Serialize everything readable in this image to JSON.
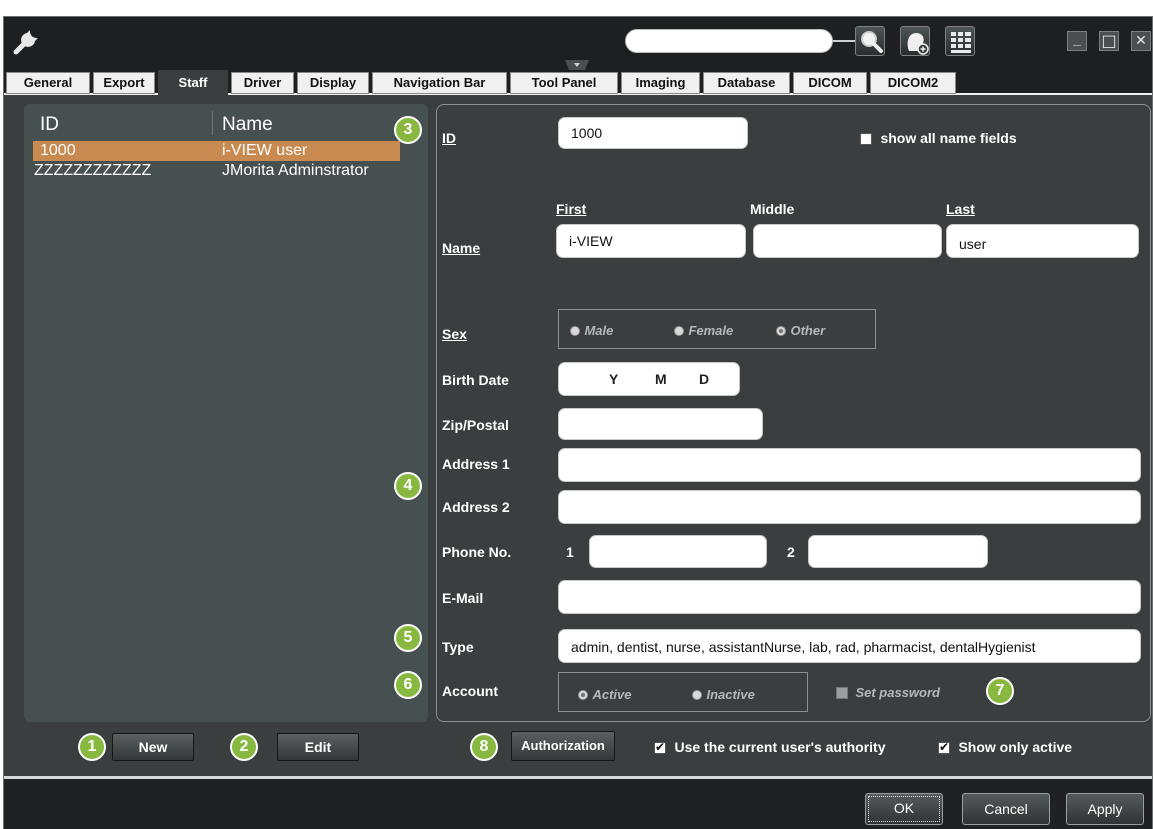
{
  "tabs": [
    "General",
    "Export",
    "Staff",
    "Driver",
    "Display",
    "Navigation Bar",
    "Tool Panel",
    "Imaging",
    "Database",
    "DICOM",
    "DICOM2"
  ],
  "active_tab": "Staff",
  "search": {
    "value": "",
    "placeholder": ""
  },
  "window_controls": {
    "minimize": "_",
    "maximize": "□",
    "close": "✕"
  },
  "list": {
    "headers": {
      "id": "ID",
      "name": "Name"
    },
    "rows": [
      {
        "id": "1000",
        "name": "i-VIEW user",
        "selected": true
      },
      {
        "id": "ZZZZZZZZZZZZ",
        "name": "JMorita Adminstrator",
        "selected": false
      }
    ]
  },
  "form": {
    "id_label": "ID",
    "id_value": "1000",
    "show_all_label": "show all name fields",
    "name_label": "Name",
    "first_label": "First",
    "middle_label": "Middle",
    "last_label": "Last",
    "first_value": "i-VIEW",
    "middle_value": "",
    "last_value": "user",
    "sex_label": "Sex",
    "sex_options": [
      "Male",
      "Female",
      "Other"
    ],
    "sex_selected": "Other",
    "birth_label": "Birth Date",
    "birth_y": "Y",
    "birth_m": "M",
    "birth_d": "D",
    "zip_label": "Zip/Postal",
    "address1_label": "Address 1",
    "address2_label": "Address 2",
    "phone_label": "Phone No.",
    "phone1_label": "1",
    "phone2_label": "2",
    "email_label": "E-Mail",
    "type_label": "Type",
    "type_value": "admin, dentist, nurse, assistantNurse, lab, rad, pharmacist, dentalHygienist",
    "account_label": "Account",
    "account_options": [
      "Active",
      "Inactive"
    ],
    "account_selected": "Active",
    "set_password_label": "Set password"
  },
  "badges": [
    "1",
    "2",
    "3",
    "4",
    "5",
    "6",
    "7",
    "8"
  ],
  "buttons": {
    "new": "New",
    "edit": "Edit",
    "authorization": "Authorization",
    "ok": "OK",
    "cancel": "Cancel",
    "apply": "Apply"
  },
  "checks": {
    "use_current": "Use the current user's authority",
    "show_only_active": "Show only active"
  },
  "icons": [
    "wrench-icon",
    "search-icon",
    "head-add-icon",
    "keypad-icon",
    "minimize-icon",
    "maximize-icon",
    "close-icon"
  ],
  "colors": {
    "selected_row": "#c88a50",
    "badge": "#88b840",
    "panel": "#475050",
    "window": "#3a3e3e"
  }
}
